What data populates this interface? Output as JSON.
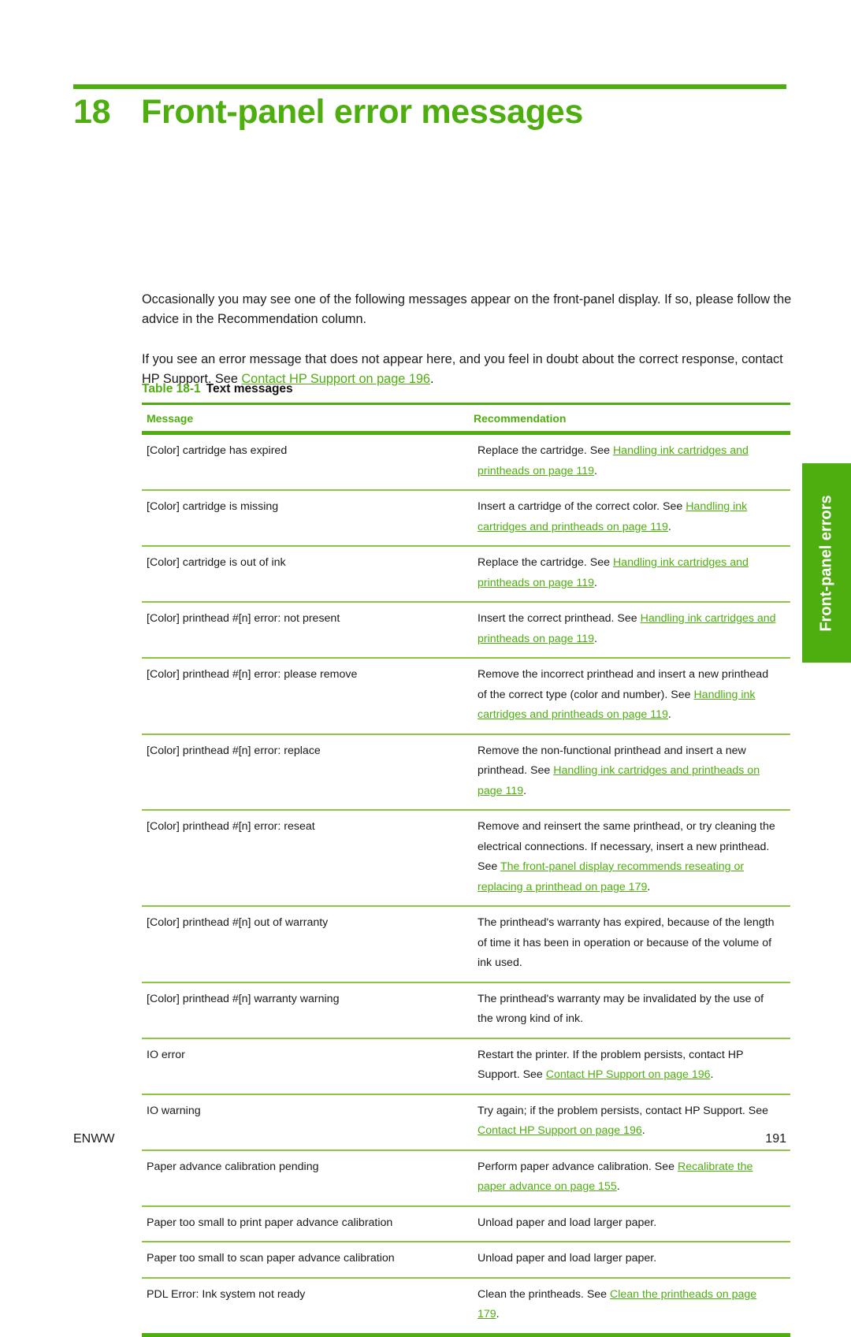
{
  "chapter": {
    "number": "18",
    "title": "Front-panel error messages",
    "accent_color": "#4fae0f"
  },
  "intro": {
    "paragraph_1": "Occasionally you may see one of the following messages appear on the front-panel display. If so, please follow the advice in the Recommendation column.",
    "paragraph_2_before": "If you see an error message that does not appear here, and you feel in doubt about the correct response, contact HP Support. See ",
    "paragraph_2_link": "Contact HP Support on page 196",
    "paragraph_2_after": "."
  },
  "table_caption": {
    "label": "Table 18-1",
    "title": "Text messages"
  },
  "table": {
    "headers": {
      "message": "Message",
      "recommendation": "Recommendation"
    },
    "rows": [
      {
        "message": "[Color] cartridge has expired",
        "rec_before": "Replace the cartridge. See ",
        "rec_link": "Handling ink cartridges and printheads on page 119",
        "rec_after": "."
      },
      {
        "message": "[Color] cartridge is missing",
        "rec_before": "Insert a cartridge of the correct color. See ",
        "rec_link": "Handling ink cartridges and printheads on page 119",
        "rec_after": "."
      },
      {
        "message": "[Color] cartridge is out of ink",
        "rec_before": "Replace the cartridge. See ",
        "rec_link": "Handling ink cartridges and printheads on page 119",
        "rec_after": "."
      },
      {
        "message": "[Color] printhead #[n] error: not present",
        "rec_before": "Insert the correct printhead. See ",
        "rec_link": "Handling ink cartridges and printheads on page 119",
        "rec_after": "."
      },
      {
        "message": "[Color] printhead #[n] error: please remove",
        "rec_before": "Remove the incorrect printhead and insert a new printhead of the correct type (color and number). See ",
        "rec_link": "Handling ink cartridges and printheads on page 119",
        "rec_after": "."
      },
      {
        "message": "[Color] printhead #[n] error: replace",
        "rec_before": "Remove the non-functional printhead and insert a new printhead. See ",
        "rec_link": "Handling ink cartridges and printheads on page 119",
        "rec_after": "."
      },
      {
        "message": "[Color] printhead #[n] error: reseat",
        "rec_before": "Remove and reinsert the same printhead, or try cleaning the electrical connections. If necessary, insert a new printhead. See ",
        "rec_link": "The front-panel display recommends reseating or replacing a printhead on page 179",
        "rec_after": "."
      },
      {
        "message": "[Color] printhead #[n] out of warranty",
        "rec_before": "The printhead's warranty has expired, because of the length of time it has been in operation or because of the volume of ink used.",
        "rec_link": "",
        "rec_after": ""
      },
      {
        "message": "[Color] printhead #[n] warranty warning",
        "rec_before": "The printhead's warranty may be invalidated by the use of the wrong kind of ink.",
        "rec_link": "",
        "rec_after": ""
      },
      {
        "message": "IO error",
        "rec_before": "Restart the printer. If the problem persists, contact HP Support. See ",
        "rec_link": "Contact HP Support on page 196",
        "rec_after": "."
      },
      {
        "message": "IO warning",
        "rec_before": "Try again; if the problem persists, contact HP Support. See ",
        "rec_link": "Contact HP Support on page 196",
        "rec_after": "."
      },
      {
        "message": "Paper advance calibration pending",
        "rec_before": "Perform paper advance calibration. See ",
        "rec_link": "Recalibrate the paper advance on page 155",
        "rec_after": "."
      },
      {
        "message": "Paper too small to print paper advance calibration",
        "rec_before": "Unload paper and load larger paper.",
        "rec_link": "",
        "rec_after": ""
      },
      {
        "message": "Paper too small to scan paper advance calibration",
        "rec_before": "Unload paper and load larger paper.",
        "rec_link": "",
        "rec_after": ""
      },
      {
        "message": "PDL Error: Ink system not ready",
        "rec_before": "Clean the printheads. See ",
        "rec_link": "Clean the printheads on page 179",
        "rec_after": "."
      }
    ]
  },
  "side_tab": {
    "label": "Front-panel errors",
    "background_color": "#4fae0f",
    "text_color": "#ffffff"
  },
  "footer": {
    "left": "ENWW",
    "page_number": "191"
  }
}
